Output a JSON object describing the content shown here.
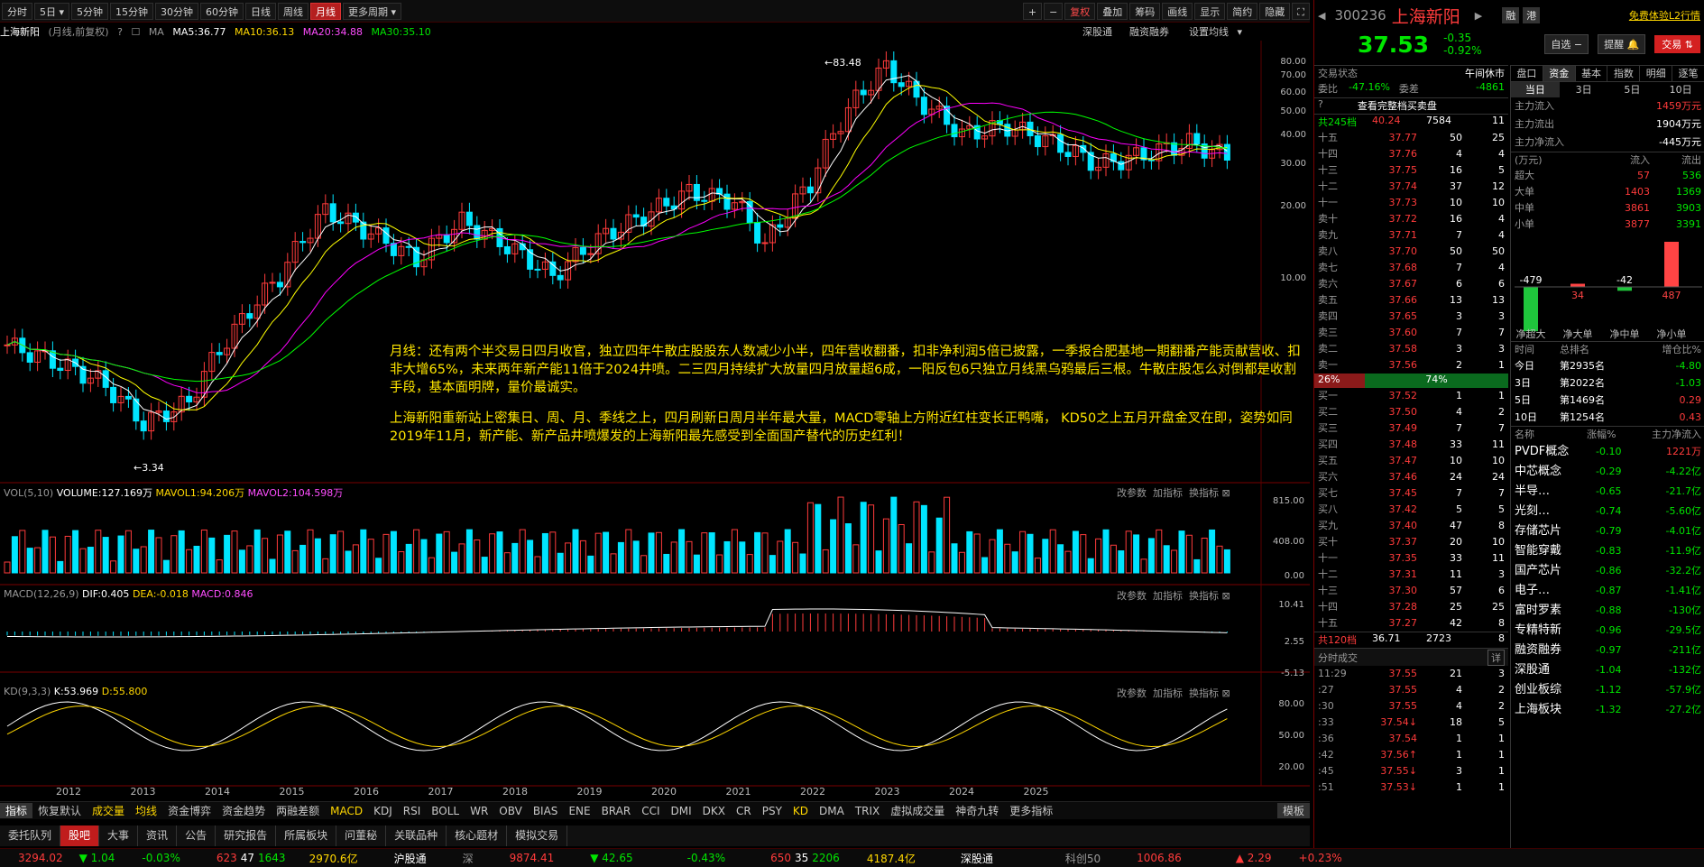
{
  "toolbar": {
    "periods": [
      "分时",
      "5日",
      "5分钟",
      "15分钟",
      "30分钟",
      "60分钟",
      "日线",
      "周线",
      "月线",
      "更多周期"
    ],
    "right": [
      "+",
      "−",
      "复权",
      "叠加",
      "筹码",
      "画线",
      "显示",
      "简约",
      "隐藏"
    ]
  },
  "ma_bar": {
    "name": "上海新阳",
    "mode": "(月线,前复权)",
    "ma": "MA",
    "ma5": "MA5:36.77",
    "ma10": "MA10:36.13",
    "ma20": "MA20:34.88",
    "ma30": "MA30:35.10",
    "links": [
      "深股通",
      "融资融券",
      "设置均线"
    ]
  },
  "annotation": {
    "p1": "月线：还有两个半交易日四月收官，独立四年牛散庄股股东人数减少小半，四年营收翻番，扣非净利润5倍已披露，一季报合肥基地一期翻番产能贡献营收、扣非大增65%，未来两年新产能11倍于2024井喷。二三四月持续扩大放量四月放量超6成，一阳反包6只独立月线黑乌鸦最后三根。牛散庄股怎么对倒都是收割手段，基本面明牌，量价最诚实。",
    "p2": "上海新阳重新站上密集日、周、月、季线之上，四月刷新日周月半年最大量，MACD零轴上方附近红柱变长正鸭嘴， KD50之上五月开盘金叉在即，姿势如同2019年11月，新产能、新产品井喷爆发的上海新阳最先感受到全面国产替代的历史红利！"
  },
  "price_labels": {
    "high": "83.48",
    "low": "3.34"
  },
  "price_axis": [
    "80.00",
    "70.00",
    "60.00",
    "50.00",
    "40.00",
    "30.00",
    "20.00",
    "10.00"
  ],
  "vol_panel": {
    "label": "VOL(5,10)",
    "volume": "VOLUME:127.169万",
    "m1": "MAVOL1:94.206万",
    "m2": "MAVOL2:104.598万",
    "axis": [
      "815.00",
      "408.00",
      "0.00"
    ],
    "links": [
      "改参数",
      "加指标",
      "换指标"
    ]
  },
  "macd_panel": {
    "label": "MACD(12,26,9)",
    "dif": "DIF:0.405",
    "dea": "DEA:-0.018",
    "macd": "MACD:0.846",
    "axis": [
      "10.41",
      "2.55",
      "-5.13"
    ]
  },
  "kd_panel": {
    "label": "KD(9,3,3)",
    "k": "K:53.969",
    "d": "D:55.800",
    "axis": [
      "80.00",
      "50.00",
      "20.00"
    ]
  },
  "years": [
    "2012",
    "2013",
    "2014",
    "2015",
    "2016",
    "2017",
    "2018",
    "2019",
    "2020",
    "2021",
    "2022",
    "2023",
    "2024",
    "2025"
  ],
  "indicator_tabs": [
    "指标",
    "恢复默认",
    "成交量",
    "均线",
    "资金博弈",
    "资金趋势",
    "两融差额",
    "MACD",
    "KDJ",
    "RSI",
    "BOLL",
    "WR",
    "OBV",
    "BIAS",
    "ENE",
    "BRAR",
    "CCI",
    "DMI",
    "DKX",
    "CR",
    "PSY",
    "KD",
    "DMA",
    "TRIX",
    "虚拟成交量",
    "神奇九转",
    "更多指标",
    "模板"
  ],
  "bottom_tabs": [
    "委托队列",
    "股吧",
    "大事",
    "资讯",
    "公告",
    "研究报告",
    "所属板块",
    "问董秘",
    "关联品种",
    "核心题材",
    "模拟交易"
  ],
  "stock": {
    "code": "300236",
    "name": "上海新阳",
    "price": "37.53",
    "chg": "-0.35",
    "pct": "-0.92%",
    "tags": [
      "融",
      "港"
    ],
    "l2": "免费体验L2行情",
    "buttons": [
      "自选",
      "提醒",
      "交易"
    ]
  },
  "rtabs": [
    "盘口",
    "资金",
    "基本",
    "指数",
    "明细",
    "逐笔"
  ],
  "ftabs": [
    "当日",
    "3日",
    "5日",
    "10日"
  ],
  "order": {
    "state_label": "交易状态",
    "state": "午间休市",
    "wb_label": "委比",
    "wb": "-47.16%",
    "wc_label": "委差",
    "wc": "-4861",
    "view_all": "查看完整档买卖盘",
    "sell_total": "共245档",
    "sell_avg": "40.24",
    "sell_vol": "7584",
    "sell_n": "11",
    "buy_total": "共120档",
    "buy_avg": "36.71",
    "buy_vol": "2723",
    "buy_n": "8",
    "ratio_l": "26%",
    "ratio_r": "74%"
  },
  "sells": [
    [
      "十五",
      "37.77",
      "50",
      "25"
    ],
    [
      "十四",
      "37.76",
      "4",
      "4"
    ],
    [
      "十三",
      "37.75",
      "16",
      "5"
    ],
    [
      "十二",
      "37.74",
      "37",
      "12"
    ],
    [
      "十一",
      "37.73",
      "10",
      "10"
    ],
    [
      "卖十",
      "37.72",
      "16",
      "4"
    ],
    [
      "卖九",
      "37.71",
      "7",
      "4"
    ],
    [
      "卖八",
      "37.70",
      "50",
      "50"
    ],
    [
      "卖七",
      "37.68",
      "7",
      "4"
    ],
    [
      "卖六",
      "37.67",
      "6",
      "6"
    ],
    [
      "卖五",
      "37.66",
      "13",
      "13"
    ],
    [
      "卖四",
      "37.65",
      "3",
      "3"
    ],
    [
      "卖三",
      "37.60",
      "7",
      "7"
    ],
    [
      "卖二",
      "37.58",
      "3",
      "3"
    ],
    [
      "卖一",
      "37.56",
      "2",
      "1"
    ]
  ],
  "buys": [
    [
      "买一",
      "37.52",
      "1",
      "1"
    ],
    [
      "买二",
      "37.50",
      "4",
      "2"
    ],
    [
      "买三",
      "37.49",
      "7",
      "7"
    ],
    [
      "买四",
      "37.48",
      "33",
      "11"
    ],
    [
      "买五",
      "37.47",
      "10",
      "10"
    ],
    [
      "买六",
      "37.46",
      "24",
      "24"
    ],
    [
      "买七",
      "37.45",
      "7",
      "7"
    ],
    [
      "买八",
      "37.42",
      "5",
      "5"
    ],
    [
      "买九",
      "37.40",
      "47",
      "8"
    ],
    [
      "买十",
      "37.37",
      "20",
      "10"
    ],
    [
      "十一",
      "37.35",
      "33",
      "11"
    ],
    [
      "十二",
      "37.31",
      "11",
      "3"
    ],
    [
      "十三",
      "37.30",
      "57",
      "6"
    ],
    [
      "十四",
      "37.28",
      "25",
      "25"
    ],
    [
      "十五",
      "37.27",
      "42",
      "8"
    ]
  ],
  "ticks_title": "分时成交",
  "ticks_more": "详",
  "ticks": [
    [
      "11:29",
      "37.55",
      "21",
      "3"
    ],
    [
      ":27",
      "37.55",
      "4",
      "2"
    ],
    [
      ":30",
      "37.55",
      "4",
      "2"
    ],
    [
      ":33",
      "37.54↓",
      "18",
      "5"
    ],
    [
      ":36",
      "37.54",
      "1",
      "1"
    ],
    [
      ":42",
      "37.56↑",
      "1",
      "1"
    ],
    [
      ":45",
      "37.55↓",
      "3",
      "1"
    ],
    [
      ":51",
      "37.53↓",
      "1",
      "1"
    ]
  ],
  "fund": {
    "in_label": "主力流入",
    "in": "1459万元",
    "out_label": "主力流出",
    "out": "1904万元",
    "net_label": "主力净流入",
    "net": "-445万元",
    "unit": "(万元)",
    "col_in": "流入",
    "col_out": "流出",
    "rows": [
      [
        "超大",
        "57",
        "536"
      ],
      [
        "大单",
        "1403",
        "1369"
      ],
      [
        "中单",
        "3861",
        "3903"
      ],
      [
        "小单",
        "3877",
        "3391"
      ]
    ],
    "bars": [
      {
        "label": "净超大",
        "value": "-479"
      },
      {
        "label": "净大单",
        "value": "34"
      },
      {
        "label": "净中单",
        "value": "-42"
      },
      {
        "label": "净小单",
        "value": "487"
      }
    ]
  },
  "rank": {
    "head": [
      "时间",
      "总排名",
      "增仓比%"
    ],
    "rows": [
      [
        "今日",
        "第2935名",
        "-4.80"
      ],
      [
        "3日",
        "第2022名",
        "-1.03"
      ],
      [
        "5日",
        "第1469名",
        "0.29"
      ],
      [
        "10日",
        "第1254名",
        "0.43"
      ]
    ]
  },
  "sectors": {
    "head": [
      "名称",
      "涨幅%",
      "主力净流入"
    ],
    "rows": [
      [
        "PVDF概念",
        "-0.10",
        "1221万"
      ],
      [
        "中芯概念",
        "-0.29",
        "-4.22亿"
      ],
      [
        "半导…",
        "-0.65",
        "-21.7亿"
      ],
      [
        "光刻…",
        "-0.74",
        "-5.60亿"
      ],
      [
        "存储芯片",
        "-0.79",
        "-4.01亿"
      ],
      [
        "智能穿戴",
        "-0.83",
        "-11.9亿"
      ],
      [
        "国产芯片",
        "-0.86",
        "-32.2亿"
      ],
      [
        "电子…",
        "-0.87",
        "-1.41亿"
      ],
      [
        "富时罗素",
        "-0.88",
        "-130亿"
      ],
      [
        "专精特新",
        "-0.96",
        "-29.5亿"
      ],
      [
        "融资融券",
        "-0.97",
        "-211亿"
      ],
      [
        "深股通",
        "-1.04",
        "-132亿"
      ],
      [
        "创业板综",
        "-1.12",
        "-57.9亿"
      ],
      [
        "上海板块",
        "-1.32",
        "-27.2亿"
      ]
    ]
  },
  "status": {
    "sh": "3294.02",
    "sh_chg": "▼ 1.04",
    "sh_pct": "-0.03%",
    "sh_up": "623",
    "sh_eq": "47",
    "sh_dn": "1643",
    "sh_amt": "2970.6亿",
    "hgt": "沪股通",
    "sz_l": "深",
    "sz": "9874.41",
    "sz_chg": "▼ 42.65",
    "sz_pct": "-0.43%",
    "sz_up": "650",
    "sz_eq": "35",
    "sz_dn": "2206",
    "sz_amt": "4187.4亿",
    "sgt": "深股通",
    "kc": "科创50",
    "kc_v": "1006.86",
    "kc_chg": "▲ 2.29",
    "kc_pct": "+0.23%"
  },
  "colors": {
    "up": "#ff3b3b",
    "down": "#00ffff",
    "ma5": "#ffffff",
    "ma10": "#ffff00",
    "ma20": "#ff00ff",
    "ma30": "#00ff00"
  }
}
